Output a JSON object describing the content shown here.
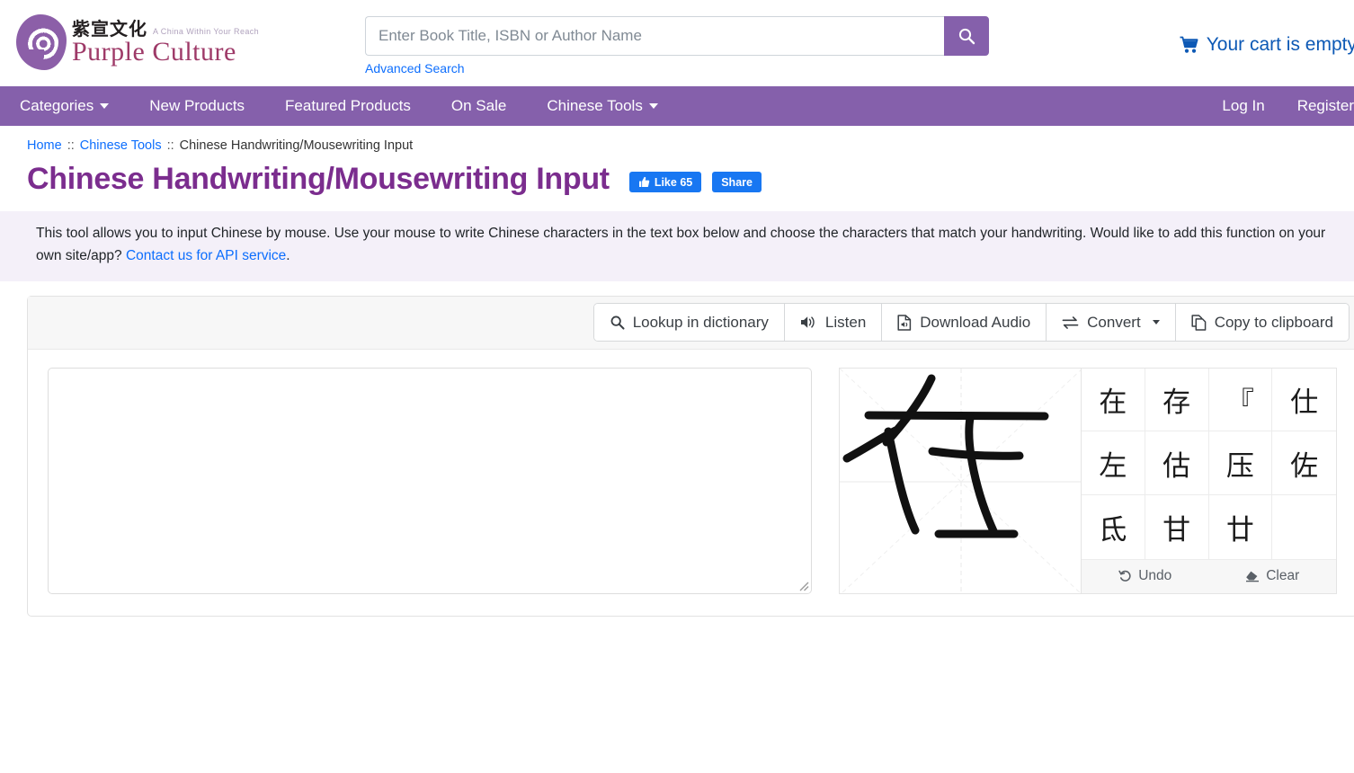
{
  "header": {
    "logo": {
      "chinese": "紫宣文化",
      "slogan": "A China Within Your Reach",
      "english": "Purple Culture"
    },
    "search": {
      "placeholder": "Enter Book Title, ISBN or Author Name",
      "value": "",
      "button_icon": "search-icon",
      "advanced_label": "Advanced Search"
    },
    "cart": {
      "icon": "shopping-cart-icon",
      "label": "Your cart is empty"
    }
  },
  "nav": {
    "items": [
      {
        "label": "Categories",
        "has_caret": true
      },
      {
        "label": "New Products",
        "has_caret": false
      },
      {
        "label": "Featured Products",
        "has_caret": false
      },
      {
        "label": "On Sale",
        "has_caret": false
      },
      {
        "label": "Chinese Tools",
        "has_caret": true
      }
    ],
    "right_items": [
      {
        "label": "Log In"
      },
      {
        "label": "Register"
      }
    ]
  },
  "breadcrumb": {
    "home": "Home",
    "sep": "::",
    "section": "Chinese Tools",
    "current": "Chinese Handwriting/Mousewriting Input"
  },
  "page": {
    "title": "Chinese Handwriting/Mousewriting Input",
    "facebook": {
      "like_label": "Like 65",
      "like_icon": "thumbs-up-icon",
      "share_label": "Share"
    },
    "description_part1": "This tool allows you to input Chinese by mouse. Use your mouse to write Chinese characters in the text box below and choose the characters that match your handwriting. Would like to add this function on your own site/app? ",
    "description_link": "Contact us for API service",
    "description_part2": "."
  },
  "toolbar": {
    "buttons": [
      {
        "label": "Lookup in dictionary",
        "icon": "search-icon",
        "caret": false
      },
      {
        "label": "Listen",
        "icon": "speaker-icon",
        "caret": false
      },
      {
        "label": "Download Audio",
        "icon": "file-audio-icon",
        "caret": false
      },
      {
        "label": "Convert",
        "icon": "exchange-arrows-icon",
        "caret": true
      },
      {
        "label": "Copy to clipboard",
        "icon": "copy-icon",
        "caret": false
      }
    ]
  },
  "editor": {
    "textarea_value": "",
    "textarea_placeholder": ""
  },
  "handwriting": {
    "canvas_name": "handwriting-canvas",
    "candidates": [
      "在",
      "存",
      "『",
      "仕",
      "左",
      "估",
      "压",
      "佐",
      "氐",
      "甘",
      "廿",
      ""
    ],
    "undo_label": "Undo",
    "undo_icon": "undo-arrow-icon",
    "clear_label": "Clear",
    "clear_icon": "eraser-icon"
  },
  "colors": {
    "brand_purple": "#8560ab",
    "title_purple": "#7b2d8e",
    "link_blue": "#0d6efd",
    "cart_blue": "#0d59b5",
    "facebook_blue": "#1877f2",
    "info_bg": "#f4f0f9",
    "toolbar_bg": "#f7f7f7"
  }
}
